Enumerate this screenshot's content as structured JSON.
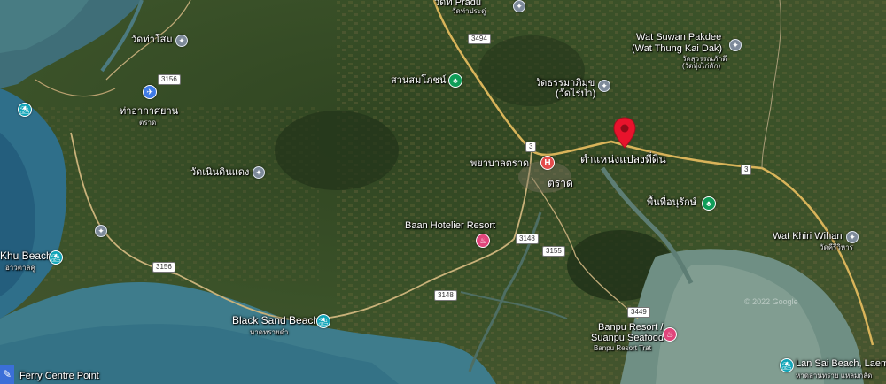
{
  "map": {
    "pin_label": "ตำแหน่งแปลงที่ดิน",
    "attribution": "© 2022 Google",
    "bottom_label": "Ferry Centre Point",
    "colors": {
      "pin": "#e8132c",
      "road": "#d9b45a",
      "water": "#4a7f8c"
    }
  },
  "labels": {
    "wat_prdu": "วัดท่าประดู่",
    "wat_prdu_short": "วัดที Pradu",
    "wat_tha_som": "วัดท่าโสม",
    "airport": "ท่าอากาศยาน",
    "airport_sub": "ตราด",
    "garden": "สวนสมโภชน์",
    "wat_suwan": "Wat Suwan Pakdee",
    "wat_suwan_2": "(Wat Thung Kai Dak)",
    "wat_suwan_th": "วัดสุวรรณภักดี",
    "wat_suwan_th2": "(วัดทุ่งไก่ดัก)",
    "wat_thammaram": "วัดธรรมาภิมุข",
    "wat_thammaram_2": "(วัดไร่ป่า)",
    "hospital": "พยาบาลตราด",
    "town": "ตราด",
    "wat_noen": "วัดเนินดินแดง",
    "conservation": "พื้นที่อนุรักษ์",
    "baan_hotelier": "Baan Hotelier Resort",
    "wat_khiri": "Wat Khiri Wihan",
    "wat_khiri_th": "วัดคีรีวิหาร",
    "khu_beach": "Khu Beach",
    "khu_beach_th": "อ่าวตาลคู่",
    "black_sand": "Black Sand Beach",
    "black_sand_th": "หาดทรายดำ",
    "banpu_1": "Banpu Resort /",
    "banpu_2": "Suanpu Seafood",
    "banpu_3": "Banpu Resort Trat",
    "lan_sai": "Lan Sai Beach, Laem",
    "lan_sai_th": "หาดลานทราย แหลมกลัด"
  },
  "routes": {
    "r3494": "3494",
    "r3156a": "3156",
    "r3156b": "3156",
    "r3a": "3",
    "r3b": "3",
    "r3148a": "3148",
    "r3148b": "3148",
    "r3155": "3155",
    "r3449": "3449"
  },
  "icons": {
    "temple": "temple-icon",
    "park": "park-icon",
    "beach": "beach-icon",
    "hotel": "hotel-icon",
    "hospital": "hospital-icon",
    "airport": "airport-icon",
    "pin": "map-pin-icon"
  }
}
